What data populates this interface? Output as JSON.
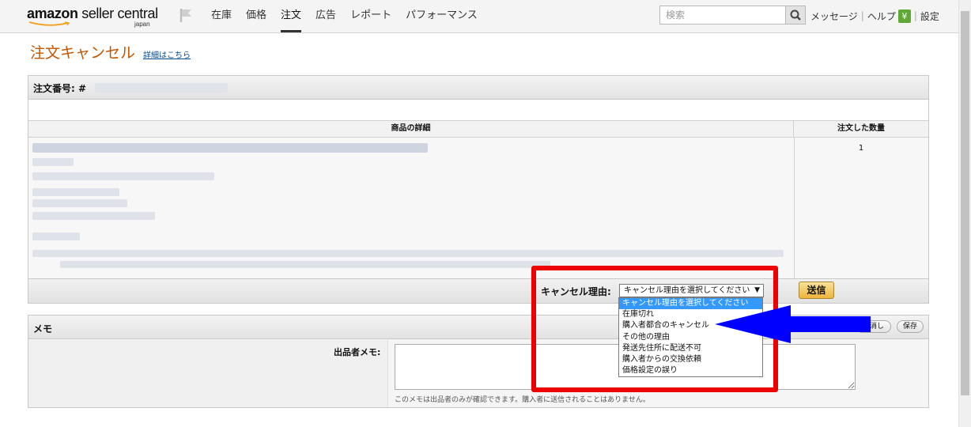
{
  "header": {
    "logo_main_regular": "amazon",
    "logo_main_bold": " seller central",
    "logo_sub": "japan",
    "nav": [
      "在庫",
      "価格",
      "注文",
      "広告",
      "レポート",
      "パフォーマンス"
    ],
    "active_nav": "注文",
    "search_placeholder": "検索",
    "messages": "メッセージ",
    "help": "ヘルプ",
    "yen_badge": "¥",
    "settings": "設定"
  },
  "page": {
    "title": "注文キャンセル",
    "detail_link": "詳細はこちら"
  },
  "order": {
    "number_label": "注文番号: #",
    "col_product": "商品の詳細",
    "col_qty": "注文した数量",
    "quantity": "1",
    "cancel_reason_label": "キャンセル理由:",
    "cancel_reason_selected": "キャンセル理由を選択してください",
    "submit_label": "送信"
  },
  "dropdown_options": [
    "キャンセル理由を選択してください",
    "在庫切れ",
    "購入者都合のキャンセル",
    "その他の理由",
    "発送先住所に配送不可",
    "購入者からの交換依頼",
    "価格設定の誤り"
  ],
  "memo": {
    "title": "メモ",
    "cancel_label": "取消し",
    "save_label": "保存",
    "seller_memo_label": "出品者メモ:",
    "note": "このメモは出品者のみが確認できます。購入者に送信されることはありません。"
  },
  "colors": {
    "brand_orange": "#c45500",
    "link_blue": "#004b91",
    "highlight_red": "#ef0000",
    "arrow_blue": "#0000ff",
    "selected_blue": "#3399ff"
  }
}
